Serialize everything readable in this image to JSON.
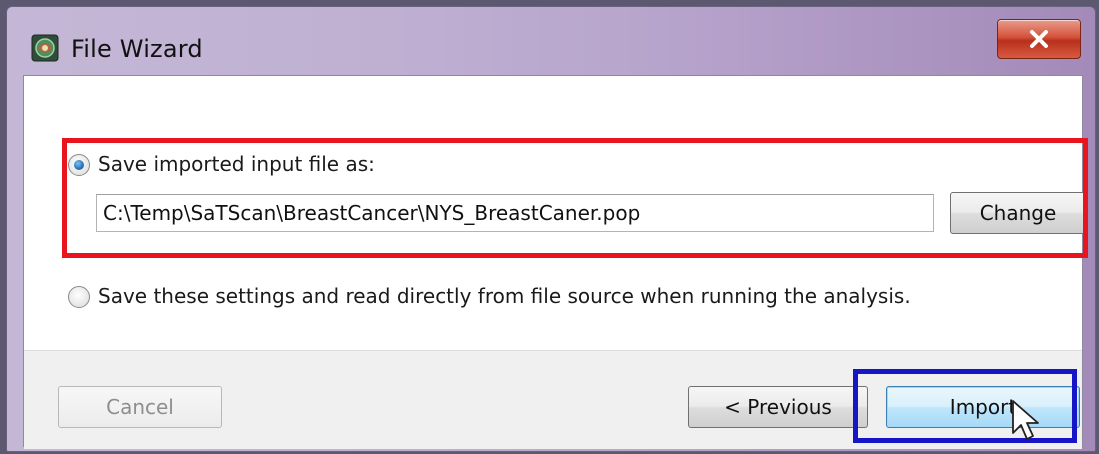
{
  "window": {
    "title": "File Wizard",
    "app_icon": "satscan-app-icon",
    "close_icon": "close-icon"
  },
  "options": {
    "save_imported": {
      "label": "Save imported input file as:",
      "selected": true,
      "path_value": "C:\\Temp\\SaTScan\\BreastCancer\\NYS_BreastCaner.pop",
      "change_label": "Change"
    },
    "read_directly": {
      "label": "Save these settings and read directly from file source when running the analysis.",
      "selected": false
    }
  },
  "buttons": {
    "cancel_label": "Cancel",
    "previous_label": "< Previous",
    "import_label": "Import"
  },
  "colors": {
    "highlight_red": "#e8141e",
    "highlight_blue": "#1616c6"
  }
}
